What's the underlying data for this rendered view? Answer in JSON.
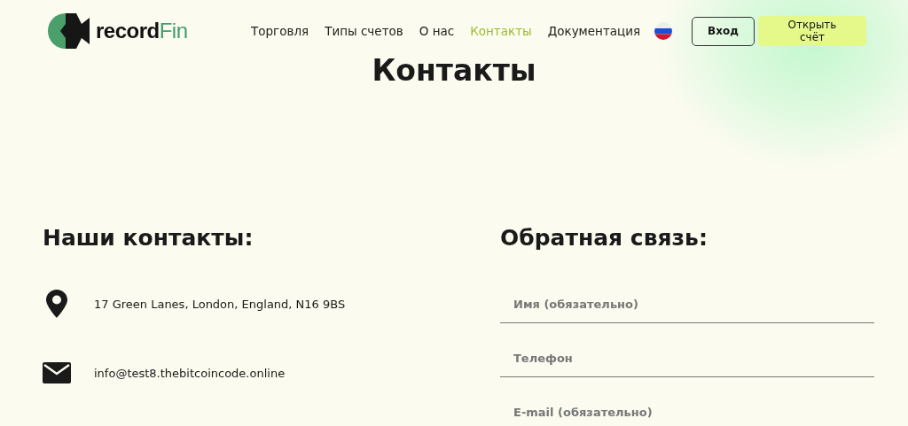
{
  "header": {
    "logo": "**record**Fin",
    "nav": [
      {
        "label": "Торговля",
        "selected": false
      },
      {
        "label": "Типы счетов",
        "selected": false
      },
      {
        "label": "О нас",
        "selected": false
      },
      {
        "label": "Контакты",
        "selected": true
      },
      {
        "label": "Документация",
        "selected": false
      }
    ],
    "login_button": "Вход",
    "open_account_button": "Открыть счёт"
  },
  "page_title": "Контакты",
  "contacts": {
    "heading": "Наши контакты:",
    "items": [
      {
        "kind": "address",
        "text": "17 Green Lanes, London, England, N16 9BS"
      },
      {
        "kind": "email",
        "text": "info@test8.thebitcoincode.online"
      }
    ]
  },
  "feedback": {
    "heading": "Обратная связь:",
    "fields": [
      {
        "placeholder": "Имя (обязательно)"
      },
      {
        "placeholder": "Телефон"
      },
      {
        "placeholder": "E-mail (обязательно)"
      }
    ]
  }
}
